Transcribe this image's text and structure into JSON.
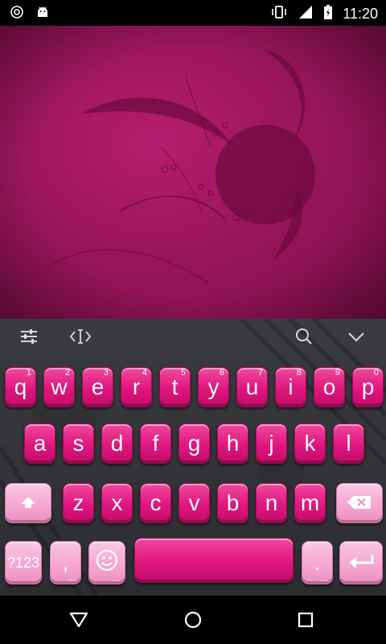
{
  "status_bar": {
    "time": "11:20",
    "left_icons": [
      "sync-icon",
      "android-icon"
    ],
    "right_icons": [
      "vibrate-icon",
      "signal-icon",
      "battery-icon"
    ]
  },
  "toolbar": {
    "icons": [
      "settings-sliders-icon",
      "cursor-icon",
      "search-icon",
      "chevron-down-icon"
    ]
  },
  "keyboard": {
    "row1": [
      {
        "label": "q",
        "hint": "1"
      },
      {
        "label": "w",
        "hint": "2"
      },
      {
        "label": "e",
        "hint": "3"
      },
      {
        "label": "r",
        "hint": "4"
      },
      {
        "label": "t",
        "hint": "5"
      },
      {
        "label": "y",
        "hint": "6"
      },
      {
        "label": "u",
        "hint": "7"
      },
      {
        "label": "i",
        "hint": "8"
      },
      {
        "label": "o",
        "hint": "9"
      },
      {
        "label": "p",
        "hint": "0"
      }
    ],
    "row2": [
      "a",
      "s",
      "d",
      "f",
      "g",
      "h",
      "j",
      "k",
      "l"
    ],
    "row3": [
      "z",
      "x",
      "c",
      "v",
      "b",
      "n",
      "m"
    ],
    "row4": {
      "symbols_label": "?123",
      "comma_label": ",",
      "period_label": ".",
      "more_dots": "…"
    }
  },
  "colors": {
    "key_pink": "#e0157e",
    "key_light_pink": "#f6a7d1",
    "wallpaper": "#9a155c",
    "keyboard_bg": "#313236"
  },
  "nav_bar": {
    "icons": [
      "back-icon",
      "home-icon",
      "recents-icon"
    ]
  }
}
